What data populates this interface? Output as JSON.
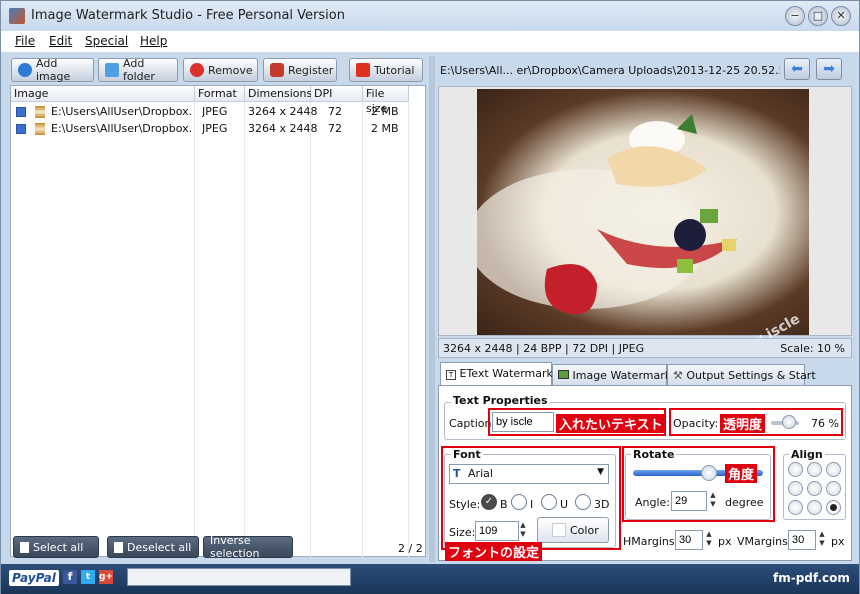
{
  "window": {
    "title": "Image Watermark Studio - Free Personal Version",
    "buttons": [
      "−",
      "□",
      "✕"
    ]
  },
  "menu": [
    "File",
    "Edit",
    "Special",
    "Help"
  ],
  "toolbar": {
    "add_image": "Add image",
    "add_folder": "Add folder",
    "remove": "Remove",
    "register": "Register",
    "tutorial": "Tutorial"
  },
  "filelist": {
    "columns": [
      "Image",
      "Format",
      "Dimensions",
      "DPI",
      "File size"
    ],
    "rows": [
      {
        "path": "E:\\Users\\AllUser\\Dropbox...",
        "format": "JPEG",
        "dimensions": "3264 x 2448",
        "dpi": "72",
        "size": "2 MB"
      },
      {
        "path": "E:\\Users\\AllUser\\Dropbox...",
        "format": "JPEG",
        "dimensions": "3264 x 2448",
        "dpi": "72",
        "size": "2 MB"
      }
    ]
  },
  "bottombar": {
    "select_all": "Select all",
    "deselect_all": "Deselect all",
    "inverse": "Inverse selection",
    "count": "2 / 2"
  },
  "preview": {
    "path": "E:\\Users\\All... er\\Dropbox\\Camera Uploads\\2013-12-25 20.52.52.jpg",
    "watermark_text": "by iscle",
    "info": "3264 x 2448  |  24 BPP  |  72 DPI  |  JPEG",
    "scale": "Scale: 10 %"
  },
  "tabs": [
    "EText Watermark",
    "Image Watermark",
    "Output Settings & Start"
  ],
  "text_props": {
    "group_title": "Text Properties",
    "caption_label": "Caption:",
    "caption_value": "by iscle",
    "caption_note": "入れたいテキスト",
    "opacity_label": "Opacity:",
    "opacity_note": "透明度",
    "opacity_value": "76 %",
    "opacity_fraction": 0.76
  },
  "font": {
    "group_title": "Font",
    "family": "Arial",
    "style_label": "Style:",
    "styles": [
      "B",
      "I",
      "U",
      "3D"
    ],
    "size_label": "Size:",
    "size_value": "109",
    "color_label": "Color",
    "note": "フォントの設定"
  },
  "rotate": {
    "group_title": "Rotate",
    "note": "角度",
    "angle_label": "Angle:",
    "angle_value": "29",
    "unit": "degree",
    "slider_fraction": 0.6
  },
  "align": {
    "group_title": "Align",
    "selected": 8
  },
  "margins": {
    "h_label": "HMargins:",
    "h_value": "30",
    "v_label": "VMargins:",
    "v_value": "30",
    "unit": "px"
  },
  "status": {
    "paypal": "PayPal",
    "site": "fm-pdf.com"
  },
  "colors": {
    "accent_red": "#e00010",
    "status_bar": "#1a3558"
  }
}
